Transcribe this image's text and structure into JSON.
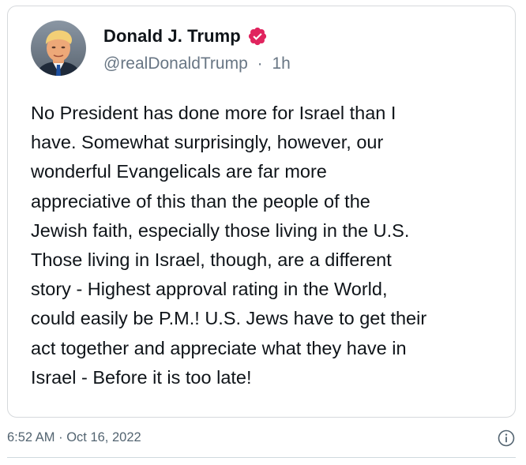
{
  "tweet": {
    "author": {
      "display_name": "Donald J. Trump",
      "handle": "@realDonaldTrump",
      "separator": "·",
      "time_ago": "1h",
      "verified_badge_icon": "verified-badge-icon",
      "verified_badge_color": "#e0245e",
      "avatar_icon": "profile-photo"
    },
    "text": "No President has done more for Israel than I have. Somewhat surprisingly, however, our wonderful Evangelicals are far more appreciative of this than the people of the Jewish faith, especially those living in the U.S. Those living in Israel, though, are a different story - Highest approval rating in the World, could easily be P.M.! U.S. Jews have to get their act together and appreciate what they have in Israel - Before it is too late!",
    "text_lines": [
      "No President has done more for Israel than I",
      "have. Somewhat surprisingly, however, our",
      "wonderful Evangelicals are far more",
      "appreciative of this than the people of the",
      "Jewish faith, especially those living in the U.S.",
      "Those living in Israel, though, are a different",
      "story - Highest approval rating in the World,",
      "could easily be P.M.! U.S. Jews have to get their",
      "act together and appreciate what they have in",
      "Israel - Before it is too late!"
    ]
  },
  "footer": {
    "timestamp": "6:52 AM · Oct 16, 2022",
    "info_icon": "info-icon"
  },
  "colors": {
    "text_primary": "#0f1419",
    "text_secondary": "#687684",
    "border": "#d6d9dc",
    "badge": "#e0245e"
  }
}
